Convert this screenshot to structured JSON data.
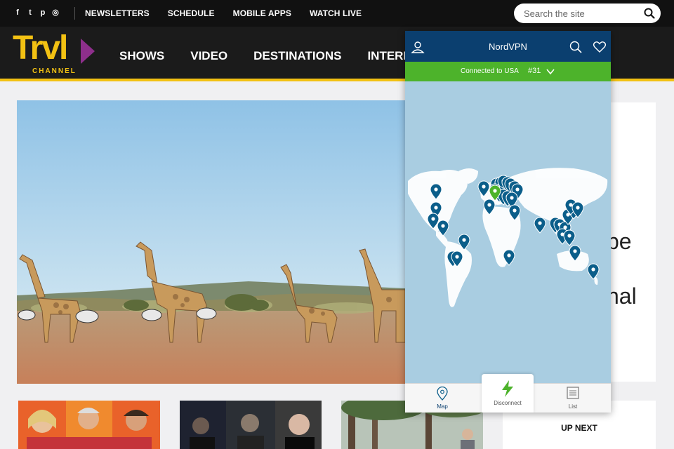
{
  "topbar": {
    "social": [
      {
        "name": "facebook-icon",
        "glyph": "f"
      },
      {
        "name": "twitter-icon",
        "glyph": "t"
      },
      {
        "name": "pinterest-icon",
        "glyph": "p"
      },
      {
        "name": "instagram-icon",
        "glyph": "◎"
      }
    ],
    "links": [
      "NEWSLETTERS",
      "SCHEDULE",
      "MOBILE APPS",
      "WATCH LIVE"
    ],
    "search_placeholder": "Search the site"
  },
  "brand": {
    "logo_text": "Trvl",
    "logo_sub": "CHANNEL",
    "color_yellow": "#f2c113",
    "color_purple": "#8e2f8c"
  },
  "nav": [
    "SHOWS",
    "VIDEO",
    "DESTINATIONS",
    "INTERES"
  ],
  "sidecard": {
    "frag1": "be",
    "frag2": "nal"
  },
  "upnext": {
    "label": "UP NEXT"
  },
  "vpn": {
    "title": "NordVPN",
    "status": "Connected to USA",
    "server": "#31",
    "tabs": {
      "map": "Map",
      "disconnect": "Disconnect",
      "list": "List"
    },
    "color_header": "#0b3f6f",
    "color_connected": "#4db32b",
    "color_pin": "#0b5e8a"
  }
}
